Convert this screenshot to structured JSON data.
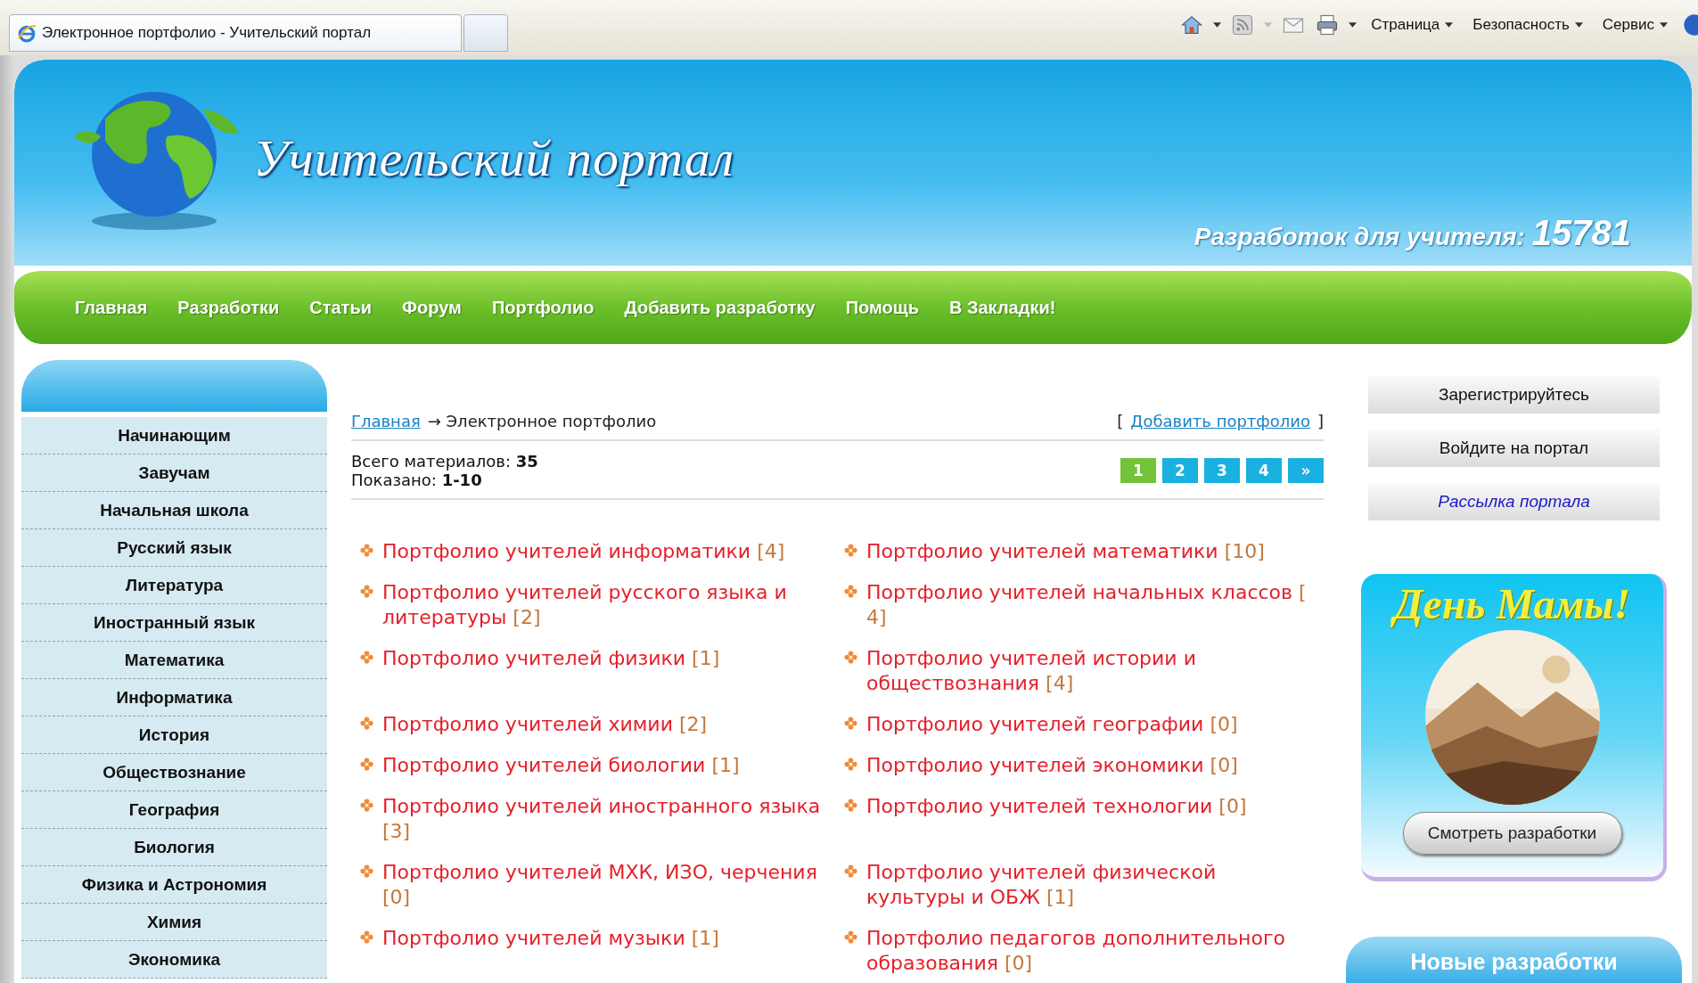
{
  "browser": {
    "tab_title": "Электронное портфолио - Учительский портал",
    "menus": [
      "Страница",
      "Безопасность",
      "Сервис"
    ]
  },
  "header": {
    "logo_text": "Учительский портал",
    "counter_label": "Разработок для учителя:",
    "counter_value": "15781"
  },
  "nav": [
    "Главная",
    "Разработки",
    "Статьи",
    "Форум",
    "Портфолио",
    "Добавить разработку",
    "Помощь",
    "В Закладки!"
  ],
  "sidebar": {
    "items": [
      "Начинающим",
      "Завучам",
      "Начальная школа",
      "Русский язык",
      "Литература",
      "Иностранный язык",
      "Математика",
      "Информатика",
      "История",
      "Обществознание",
      "География",
      "Биология",
      "Физика и Астрономия",
      "Химия",
      "Экономика"
    ]
  },
  "breadcrumb": {
    "home": "Главная",
    "current": "→ Электронное портфолио"
  },
  "add_link": {
    "open": "[",
    "label": "Добавить портфолио",
    "close": "]"
  },
  "stats": [
    "Всего материалов: **35**",
    "Показано: **1-10**"
  ],
  "pagination": [
    {
      "label": "1",
      "selected": true
    },
    {
      "label": "2",
      "selected": false
    },
    {
      "label": "3",
      "selected": false
    },
    {
      "label": "4",
      "selected": false
    },
    {
      "label": "»",
      "selected": false
    }
  ],
  "portfolios": [
    {
      "title": "Портфолио учителей информатики",
      "count": "[4]"
    },
    {
      "title": "Портфолио учителей математики",
      "count": "[10]"
    },
    {
      "title": "Портфолио учителей русского языка и литературы",
      "count": "[2]"
    },
    {
      "title": "Портфолио учителей начальных классов",
      "count": "[ 4]"
    },
    {
      "title": "Портфолио учителей физики",
      "count": "[1]"
    },
    {
      "title": "Портфолио учителей истории и обществознания",
      "count": "[4]"
    },
    {
      "title": "Портфолио учителей химии",
      "count": "[2]"
    },
    {
      "title": "Портфолио учителей географии",
      "count": "[0]"
    },
    {
      "title": "Портфолио учителей биологии",
      "count": "[1]"
    },
    {
      "title": "Портфолио учителей экономики",
      "count": "[0]"
    },
    {
      "title": "Портфолио учителей иностранного языка",
      "count": "[3]"
    },
    {
      "title": "Портфолио учителей технологии",
      "count": "[0]"
    },
    {
      "title": "Портфолио учителей МХК, ИЗО, черчения",
      "count": "[0]"
    },
    {
      "title": "Портфолио учителей физической культуры и ОБЖ",
      "count": "[1]"
    },
    {
      "title": "Портфолио учителей музыки",
      "count": "[1]"
    },
    {
      "title": "Портфолио педагогов дополнительного образования",
      "count": "[0]"
    }
  ],
  "account_links": [
    {
      "label": "Зарегистрируйтесь",
      "kind": "plain"
    },
    {
      "label": "Войдите на портал",
      "kind": "plain"
    },
    {
      "label": "Рассылка портала",
      "kind": "italic"
    }
  ],
  "banner": {
    "title": "День Мамы!",
    "button": "Смотреть разработки"
  },
  "new_section": {
    "title": "Новые разработки"
  }
}
